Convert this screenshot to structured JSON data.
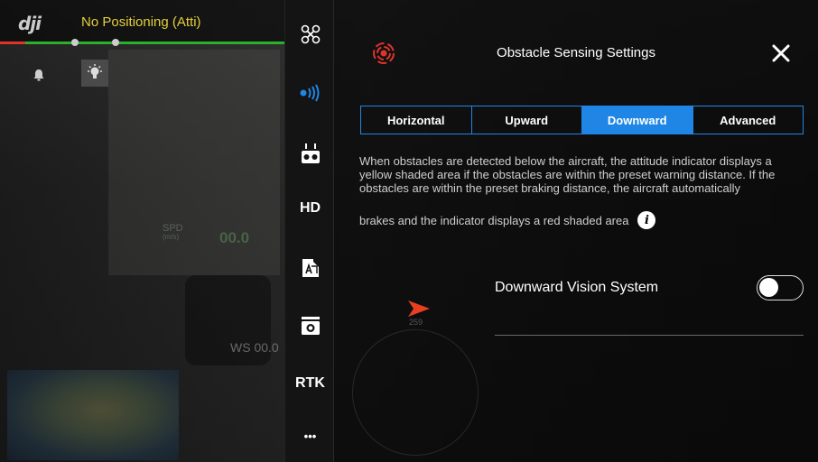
{
  "status_bar": {
    "logo_text": "dji",
    "flight_mode": "No Positioning (Atti)"
  },
  "hud": {
    "spd_label": "SPD",
    "spd_unit": "(m/s)",
    "spd_value": "00.0",
    "ws_value": "WS 00.0",
    "heading_value": "259"
  },
  "sidebar": {
    "items": [
      {
        "icon": "aircraft-icon"
      },
      {
        "icon": "sensor-signal-icon"
      },
      {
        "icon": "remote-controller-icon"
      },
      {
        "icon": "hd-icon",
        "label": "HD"
      },
      {
        "icon": "battery-icon"
      },
      {
        "icon": "camera-icon"
      },
      {
        "icon": "rtk-icon",
        "label": "RTK"
      },
      {
        "icon": "more-icon",
        "label": "•••"
      }
    ]
  },
  "panel": {
    "title": "Obstacle Sensing Settings",
    "tabs": [
      {
        "label": "Horizontal",
        "active": false
      },
      {
        "label": "Upward",
        "active": false
      },
      {
        "label": "Downward",
        "active": true
      },
      {
        "label": "Advanced",
        "active": false
      }
    ],
    "description": "When obstacles are detected below the aircraft, the attitude indicator displays a yellow shaded area if the obstacles are within the preset warning distance. If the obstacles are within the preset braking distance, the aircraft automatically",
    "description_last_line": "brakes and the indicator displays a red shaded area",
    "setting": {
      "label": "Downward Vision System",
      "enabled": false
    }
  },
  "colors": {
    "accent": "#1f86e6",
    "mode_text": "#e4cf3a",
    "status_green": "#2bb02b",
    "status_red": "#e0342a",
    "radar_red": "#e0342a"
  }
}
